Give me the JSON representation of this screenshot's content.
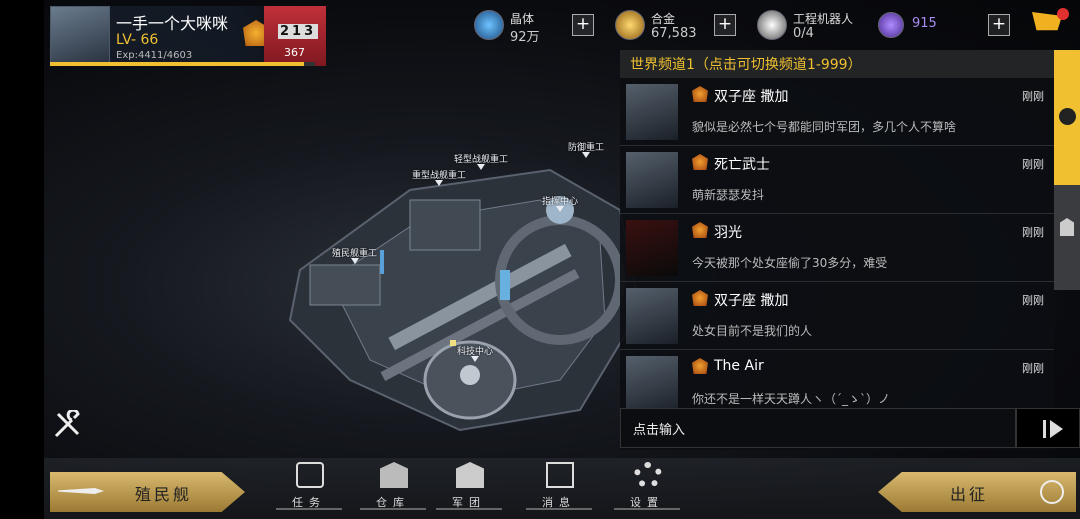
{
  "player": {
    "name": "一手一个大咪咪",
    "level": "LV- 66",
    "exp": "Exp:4411/4603",
    "exp_fraction": 0.9589,
    "podium_digits": "213",
    "score": "367"
  },
  "resources": [
    {
      "name": "晶体",
      "value": "92万",
      "icon": "crystal-icon"
    },
    {
      "name": "合金",
      "value": "67,583",
      "icon": "alloy-icon"
    },
    {
      "name": "工程机器人",
      "value": "0/4",
      "icon": "robot-icon"
    },
    {
      "name": "",
      "value": "915",
      "icon": "u-currency-icon"
    }
  ],
  "buildings": [
    "轻型战舰重工",
    "重型战舰重工",
    "防御重工",
    "指挥中心",
    "殖民舰重工",
    "科技中心"
  ],
  "chat": {
    "header": "世界频道1（点击可切换频道1-999）",
    "input_placeholder": "点击输入",
    "messages": [
      {
        "user": "双子座 撒加",
        "time": "刚刚",
        "text": "貌似是必然七个号都能同时军团，多几个人不算啥"
      },
      {
        "user": "死亡武士",
        "time": "刚刚",
        "text": "萌新瑟瑟发抖"
      },
      {
        "user": "羽光",
        "time": "刚刚",
        "text": "今天被那个处女座偷了30多分，难受"
      },
      {
        "user": "双子座 撒加",
        "time": "刚刚",
        "text": "处女目前不是我们的人"
      },
      {
        "user": "The Air",
        "time": "刚刚",
        "text": "你还不是一样天天蹲人ヽ（´_ゝ`）ノ"
      }
    ]
  },
  "bottom": {
    "ship_button": "殖民舰",
    "go_button": "出征",
    "menu": [
      {
        "label": "任务",
        "icon": "task-icon"
      },
      {
        "label": "仓库",
        "icon": "warehouse-icon"
      },
      {
        "label": "军团",
        "icon": "legion-icon"
      },
      {
        "label": "消息",
        "icon": "message-icon"
      },
      {
        "label": "设置",
        "icon": "settings-icon"
      }
    ]
  },
  "colors": {
    "accent": "#f0c030",
    "gold_button": "#c9a85a"
  }
}
